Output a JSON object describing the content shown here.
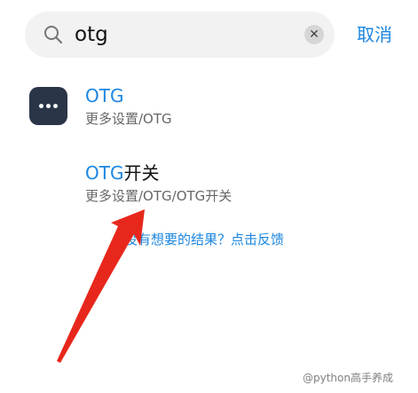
{
  "search": {
    "query": "otg",
    "icon": "search-icon",
    "clear_icon": "clear-icon",
    "clear_glyph": "✕",
    "cancel_label": "取消"
  },
  "results": [
    {
      "icon": "more-dots-icon",
      "title_highlight": "OTG",
      "title_rest": "",
      "path": "更多设置/OTG"
    },
    {
      "title_highlight": "OTG",
      "title_rest": "开关",
      "path": "更多设置/OTG/OTG开关"
    }
  ],
  "feedback": {
    "label": "没有想要的结果？点击反馈"
  },
  "annotation": {
    "type": "red-arrow",
    "color": "#e8271c"
  },
  "watermark": {
    "text": "@python高手养成"
  },
  "colors": {
    "accent": "#1b86e0",
    "icon_bg": "#2a3548",
    "search_bg": "#f2f2f2"
  }
}
